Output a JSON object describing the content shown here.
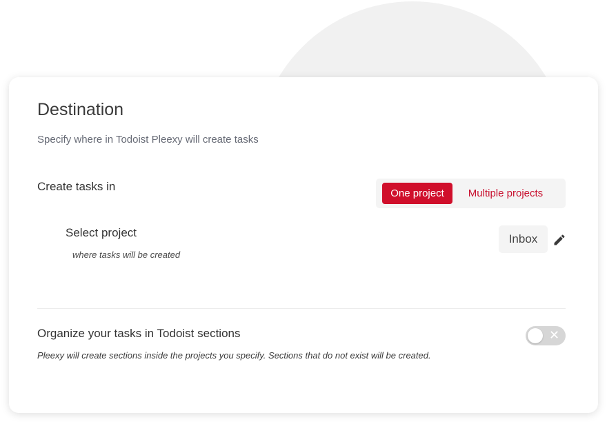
{
  "destination": {
    "title": "Destination",
    "subtitle": "Specify where in Todoist Pleexy will create tasks"
  },
  "create_tasks": {
    "label": "Create tasks in",
    "options": [
      {
        "label": "One project",
        "selected": true
      },
      {
        "label": "Multiple projects",
        "selected": false
      }
    ]
  },
  "select_project": {
    "label": "Select project",
    "help": "where tasks will be created",
    "value": "Inbox",
    "edit_icon": "pencil-icon"
  },
  "sections": {
    "label": "Organize your tasks in Todoist sections",
    "help": "Pleexy will create sections inside the projects you specify. Sections that do not exist will be created.",
    "toggle_on": false,
    "toggle_off_glyph": "✕"
  },
  "colors": {
    "accent": "#d00f2b",
    "accent_text": "#c8102e",
    "toggle_off": "#d6d6d6"
  }
}
